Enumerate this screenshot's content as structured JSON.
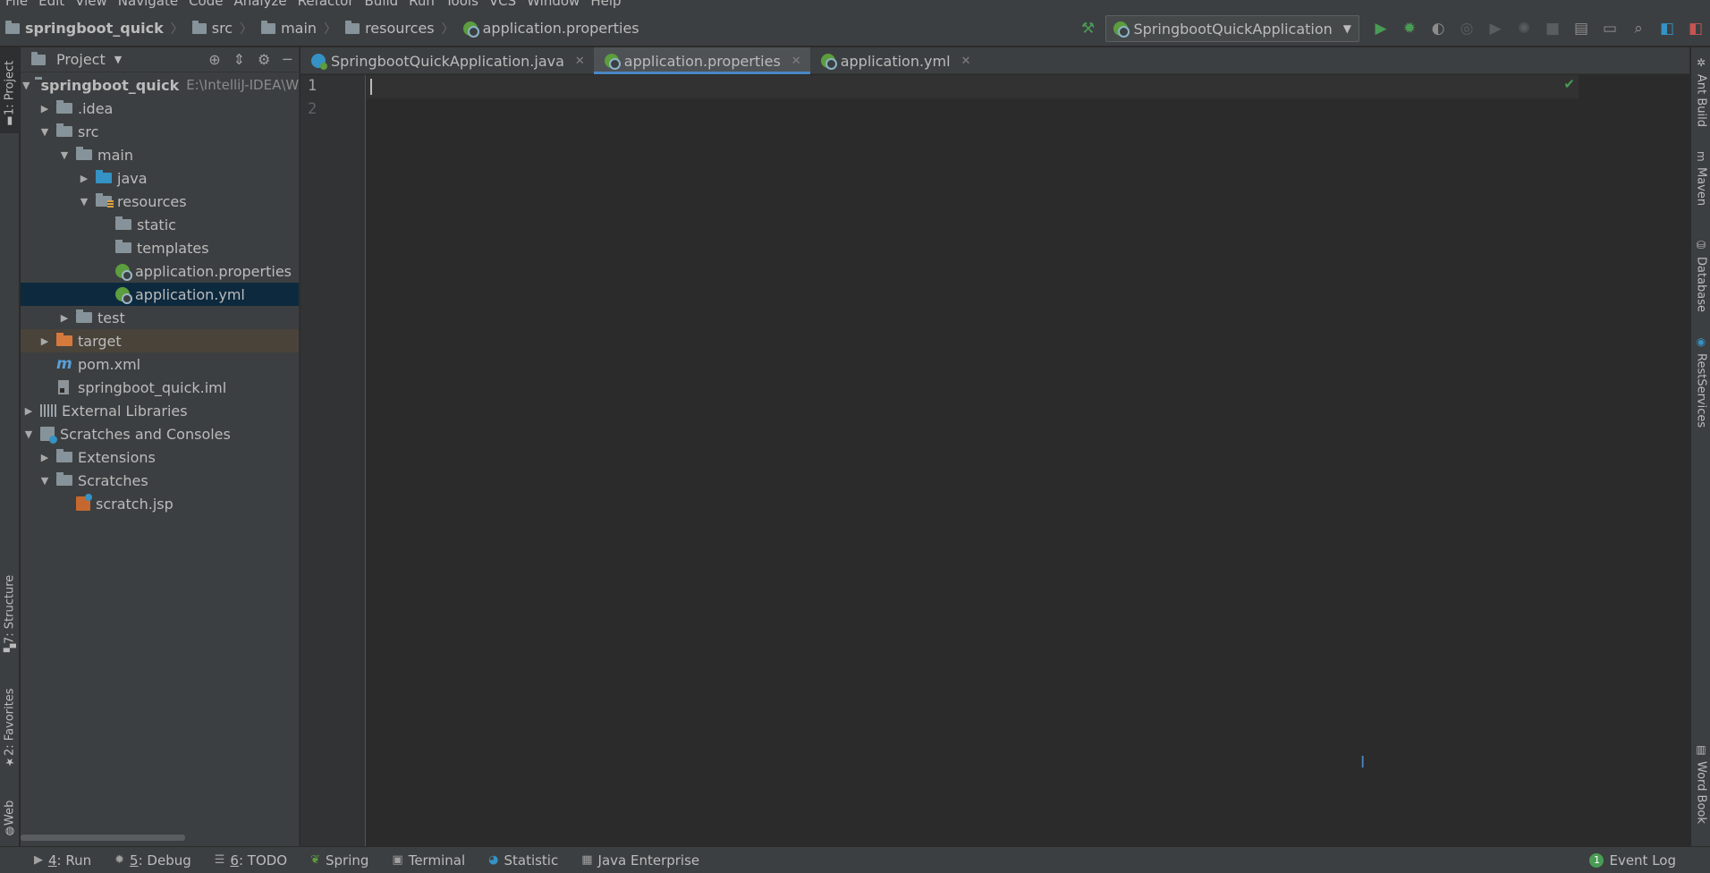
{
  "menu": [
    "File",
    "Edit",
    "View",
    "Navigate",
    "Code",
    "Analyze",
    "Refactor",
    "Build",
    "Run",
    "Tools",
    "VCS",
    "Window",
    "Help"
  ],
  "breadcrumbs": [
    "springboot_quick",
    "src",
    "main",
    "resources",
    "application.properties"
  ],
  "run_config": "SpringbootQuickApplication",
  "left_stripe": {
    "project": "1: Project",
    "structure": "7: Structure",
    "favorites": "2: Favorites",
    "web": "Web"
  },
  "right_stripe": {
    "ant": "Ant Build",
    "maven": "Maven",
    "database": "Database",
    "rest": "RestServices",
    "wordbook": "Word Book"
  },
  "project_panel": {
    "title": "Project",
    "tree": [
      {
        "label": "springboot_quick",
        "path": "E:\\IntelliJ-IDEA\\W"
      },
      {
        "label": ".idea"
      },
      {
        "label": "src"
      },
      {
        "label": "main"
      },
      {
        "label": "java"
      },
      {
        "label": "resources"
      },
      {
        "label": "static"
      },
      {
        "label": "templates"
      },
      {
        "label": "application.properties"
      },
      {
        "label": "application.yml"
      },
      {
        "label": "test"
      },
      {
        "label": "target"
      },
      {
        "label": "pom.xml"
      },
      {
        "label": "springboot_quick.iml"
      },
      {
        "label": "External Libraries"
      },
      {
        "label": "Scratches and Consoles"
      },
      {
        "label": "Extensions"
      },
      {
        "label": "Scratches"
      },
      {
        "label": "scratch.jsp"
      }
    ]
  },
  "editor_tabs": [
    "SpringbootQuickApplication.java",
    "application.properties",
    "application.yml"
  ],
  "line_numbers": [
    "1",
    "2"
  ],
  "bottom_tools": {
    "run": {
      "key": "4",
      "label": ": Run"
    },
    "debug": {
      "key": "5",
      "label": ": Debug"
    },
    "todo": {
      "key": "6",
      "label": ": TODO"
    },
    "spring": "Spring",
    "terminal": "Terminal",
    "statistic": "Statistic",
    "java_enterprise": "Java Enterprise",
    "event_log": "Event Log",
    "event_count": "1"
  }
}
